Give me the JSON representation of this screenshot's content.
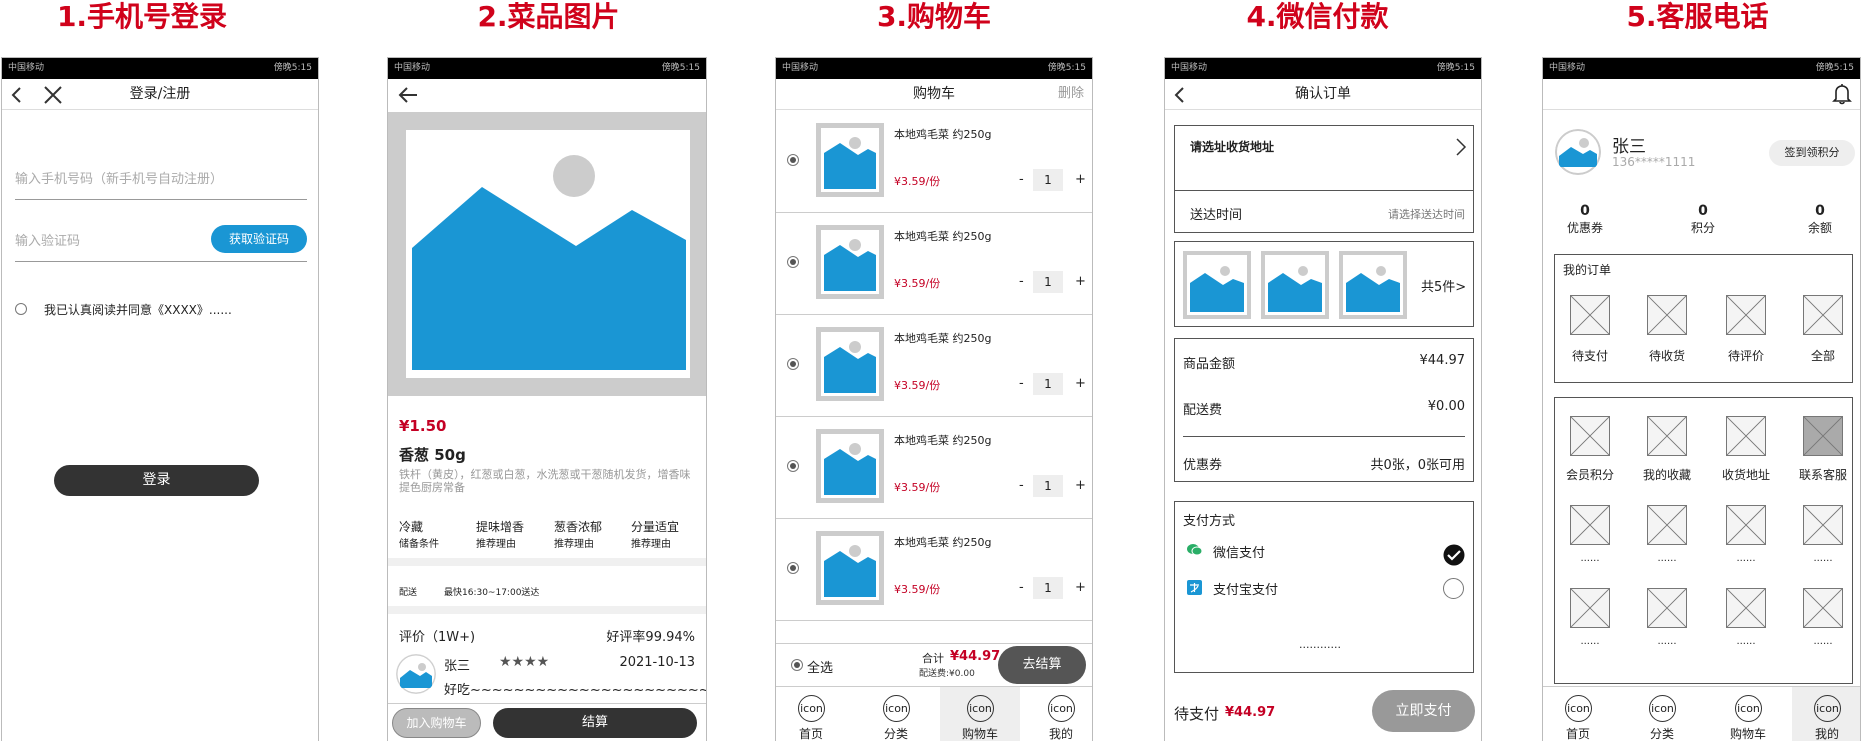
{
  "headings": [
    "1.手机号登录",
    "2.菜品图片",
    "3.购物车",
    "4.微信付款",
    "5.客服电话"
  ],
  "status": {
    "carrier": "中国移动",
    "time": "傍晚5:15"
  },
  "icons": {
    "back": "back-chevron-icon",
    "close": "close-x-icon",
    "arrow_left": "arrow-left-icon",
    "bell": "bell-icon",
    "check": "check-circle-icon",
    "wechat": "wechat-icon",
    "alipay": "alipay-icon"
  },
  "colors": {
    "heading": "#d0021b",
    "accent_blue": "#1a96d4",
    "price_red": "#c40024",
    "dark_button": "#333333"
  },
  "login": {
    "title": "登录/注册",
    "phone_placeholder": "输入手机号码（新手机号自动注册）",
    "code_placeholder": "输入验证码",
    "get_code": "获取验证码",
    "agree": "我已认真阅读并同意《XXXX》......",
    "login_btn": "登录"
  },
  "dish": {
    "price": "¥1.50",
    "name": "香葱 50g",
    "desc": "铁杆（黄皮），红葱或白葱，水洗葱或干葱随机发货，增香味提色厨房常备",
    "features": [
      {
        "title": "冷藏",
        "sub": "储备条件"
      },
      {
        "title": "提味增香",
        "sub": "推荐理由"
      },
      {
        "title": "葱香浓郁",
        "sub": "推荐理由"
      },
      {
        "title": "分量适宜",
        "sub": "推荐理由"
      }
    ],
    "delivery_label": "配送",
    "delivery_value": "最快16:30~17:00送达",
    "review_label": "评价（1W+)",
    "good_rate": "好评率99.94%",
    "reviewer": "张三",
    "stars": "★★★★",
    "review_date": "2021-10-13",
    "review_text": "好吃~~~~~~~~~~~~~~~~~~~~~~~~~",
    "add_cart": "加入购物车",
    "checkout": "结算"
  },
  "cart": {
    "title": "购物车",
    "delete": "删除",
    "items": [
      {
        "name": "本地鸡毛菜 约250g",
        "price": "¥3.59/份",
        "qty": "1",
        "minus": "-",
        "plus": "+"
      },
      {
        "name": "本地鸡毛菜 约250g",
        "price": "¥3.59/份",
        "qty": "1",
        "minus": "-",
        "plus": "+"
      },
      {
        "name": "本地鸡毛菜 约250g",
        "price": "¥3.59/份",
        "qty": "1",
        "minus": "-",
        "plus": "+"
      },
      {
        "name": "本地鸡毛菜 约250g",
        "price": "¥3.59/份",
        "qty": "1",
        "minus": "-",
        "plus": "+"
      },
      {
        "name": "本地鸡毛菜 约250g",
        "price": "¥3.59/份",
        "qty": "1",
        "minus": "-",
        "plus": "+"
      }
    ],
    "select_all": "全选",
    "total_label": "合计",
    "total": "¥44.97",
    "shipping": "配送费:¥0.00",
    "checkout": "去结算"
  },
  "tabs": [
    {
      "icon": "icon",
      "label": "首页"
    },
    {
      "icon": "icon",
      "label": "分类"
    },
    {
      "icon": "icon",
      "label": "购物车"
    },
    {
      "icon": "icon",
      "label": "我的"
    }
  ],
  "order": {
    "title": "确认订单",
    "address": "请选址收货地址",
    "time_label": "送达时间",
    "time_value": "请选择送达时间",
    "count": "共5件>",
    "goods_label": "商品金额",
    "goods_value": "¥44.97",
    "ship_label": "配送费",
    "ship_value": "¥0.00",
    "coupon_label": "优惠券",
    "coupon_value": "共0张，0张可用",
    "pay_title": "支付方式",
    "wechat": "微信支付",
    "alipay": "支付宝支付",
    "dots": "............",
    "pending_label": "待支付",
    "pending_value": "¥44.97",
    "pay_btn": "立即支付"
  },
  "profile": {
    "name": "张三",
    "phone": "136*****1111",
    "signin": "签到领积分",
    "stats": [
      {
        "value": "0",
        "label": "优惠券"
      },
      {
        "value": "0",
        "label": "积分"
      },
      {
        "value": "0",
        "label": "余额"
      }
    ],
    "orders_title": "我的订单",
    "orders": [
      "待支付",
      "待收货",
      "待评价",
      "全部"
    ],
    "services": [
      "会员积分",
      "我的收藏",
      "收货地址",
      "联系客服"
    ],
    "more": "......"
  }
}
